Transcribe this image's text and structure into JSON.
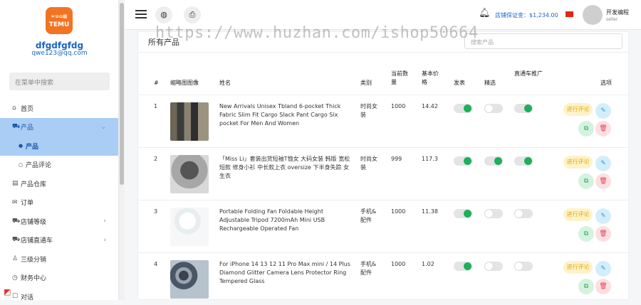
{
  "sidebar": {
    "logo_text": "TEMU",
    "shop_name": "dfgdfgfdg",
    "shop_email": "qwe123@qq.com",
    "search_placeholder": "在菜单中搜索",
    "items": [
      {
        "label": "首页",
        "icon": "home-icon"
      },
      {
        "label": "产品",
        "icon": "cart-icon",
        "expanded": true
      },
      {
        "label": "产品",
        "sub": true,
        "active": true
      },
      {
        "label": "产品评论",
        "sub": true
      },
      {
        "label": "产品仓库",
        "icon": "warehouse-icon"
      },
      {
        "label": "订单",
        "icon": "order-icon"
      },
      {
        "label": "店铺等级",
        "icon": "cart-icon",
        "arrow": "›"
      },
      {
        "label": "店铺直通车",
        "icon": "cart-icon",
        "arrow": "›"
      },
      {
        "label": "三级分销",
        "icon": "user-icon"
      },
      {
        "label": "财务中心",
        "icon": "finance-icon"
      },
      {
        "label": "对话",
        "icon": "chat-icon"
      }
    ]
  },
  "topbar": {
    "deposit_label": "店铺保证金：$1,234.00",
    "user_name": "开发编程",
    "user_role": "seller"
  },
  "page": {
    "title": "所有产品",
    "search_placeholder": "搜索产品",
    "watermark": "https://www.huzhan.com/ishop50664"
  },
  "table": {
    "headers": {
      "num": "#",
      "thumb": "缩略图图像",
      "name": "姓名",
      "category": "类别",
      "qty": "当前数量",
      "price": "基本价格",
      "publish": "发表",
      "featured": "精选",
      "promo": "直通车推广",
      "options": "选项"
    },
    "action_labels": {
      "review": "进行评论"
    },
    "rows": [
      {
        "num": "1",
        "name": "New Arrivals Unisex Tbland 6-pocket Thick Fabric Slim Fit Cargo Slack Pant Cargo Six pocket For Men And Women",
        "category": "时尚女装",
        "qty": "1000",
        "price": "14.42",
        "publish": true,
        "featured": false,
        "promo": true
      },
      {
        "num": "2",
        "name": "「Miss Li」套装出货短袖T恤女 大码女装 韩版 宽松 短款 修身小衫 中长款上衣 oversize 下半身失踪 女生衣",
        "category": "时尚女装",
        "qty": "999",
        "price": "117.3",
        "publish": true,
        "featured": true,
        "promo": true
      },
      {
        "num": "3",
        "name": "Portable Folding Fan Foldable Height Adjustable Tripod 7200mAh Mini USB Rechargeable Operated Fan",
        "category": "手机&配件",
        "qty": "1000",
        "price": "11.38",
        "publish": true,
        "featured": false,
        "promo": false
      },
      {
        "num": "4",
        "name": "For iPhone 14 13 12 11 Pro Max mini / 14 Plus Diamond Glitter Camera Lens Protector Ring Tempered Glass",
        "category": "手机&配件",
        "qty": "1000",
        "price": "1.02",
        "publish": true,
        "featured": false,
        "promo": false
      }
    ]
  }
}
